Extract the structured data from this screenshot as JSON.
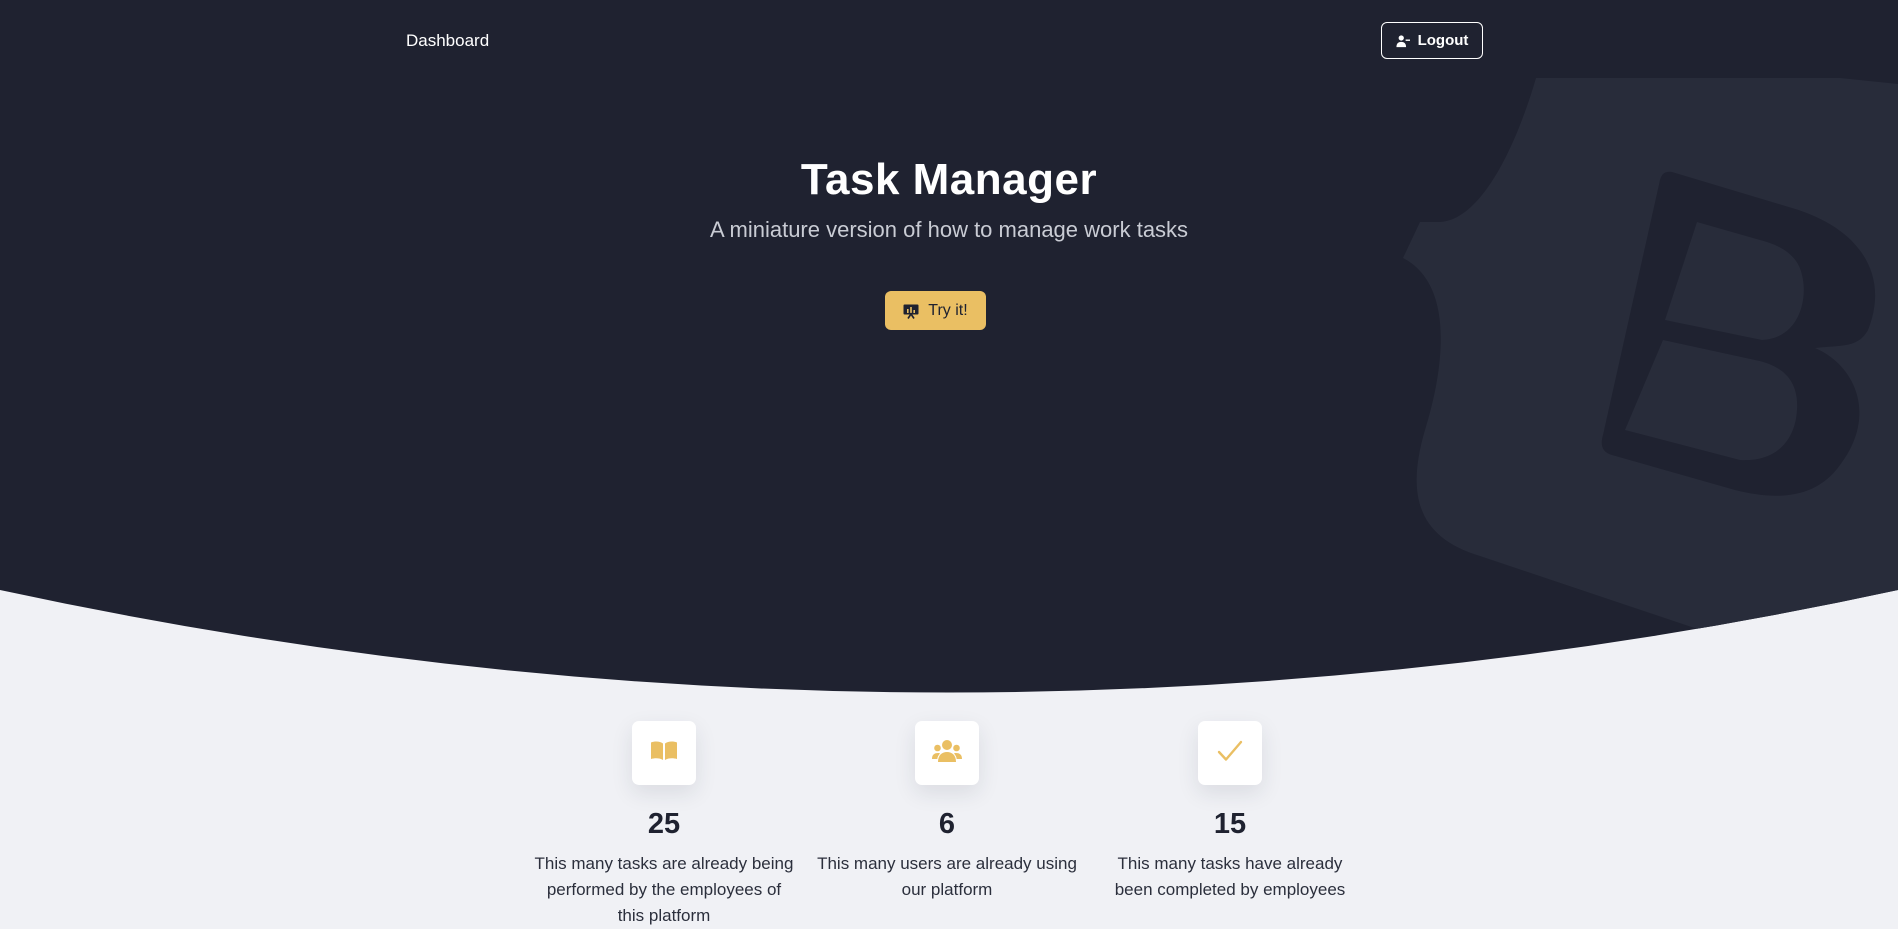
{
  "navbar": {
    "brand_label": "Dashboard",
    "logout_label": "Logout",
    "logout_icon": "user-minus-icon"
  },
  "hero": {
    "title": "Task Manager",
    "subtitle": "A miniature version of how to manage work tasks",
    "cta_label": "Try it!",
    "cta_icon": "presentation-chart-icon",
    "watermark_icon": "bootstrap-logo"
  },
  "stats": [
    {
      "icon": "book-open-icon",
      "value": "25",
      "description": "This many tasks are already being performed by the employees of this platform"
    },
    {
      "icon": "users-icon",
      "value": "6",
      "description": "This many users are already using our platform"
    },
    {
      "icon": "check-icon",
      "value": "15",
      "description": "This many tasks have already been completed by employees"
    }
  ],
  "colors": {
    "hero_background": "#1f2230",
    "page_background": "#f0f1f5",
    "accent": "#eabf63",
    "text_dark": "#1f2230"
  }
}
